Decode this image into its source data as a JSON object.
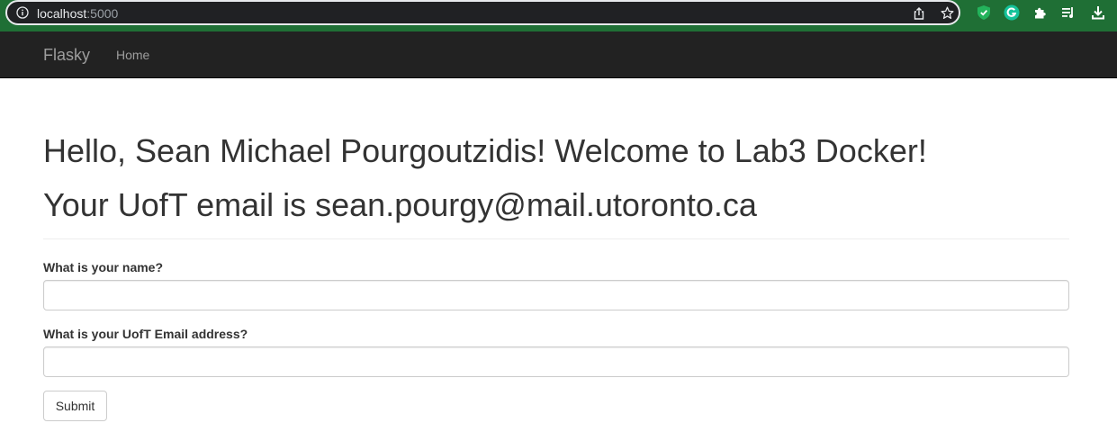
{
  "browser": {
    "url_host": "localhost",
    "url_port": ":5000",
    "icons": [
      "info-icon",
      "share-icon",
      "star-icon",
      "shield-extension-icon",
      "grammarly-extension-icon",
      "extensions-puzzle-icon",
      "reading-list-icon",
      "download-icon"
    ],
    "colors": {
      "frame": "#1f6f35",
      "omnibox": "#202124"
    }
  },
  "navbar": {
    "brand": "Flasky",
    "links": [
      "Home"
    ],
    "colors": {
      "background": "#222222",
      "text": "#9d9d9d"
    }
  },
  "main": {
    "greeting": "Hello, Sean Michael Pourgoutzidis! Welcome to Lab3 Docker!",
    "email_line": "Your UofT email is sean.pourgy@mail.utoronto.ca"
  },
  "form": {
    "name_label": "What is your name?",
    "name_value": "",
    "email_label": "What is your UofT Email address?",
    "email_value": "",
    "submit_label": "Submit"
  }
}
